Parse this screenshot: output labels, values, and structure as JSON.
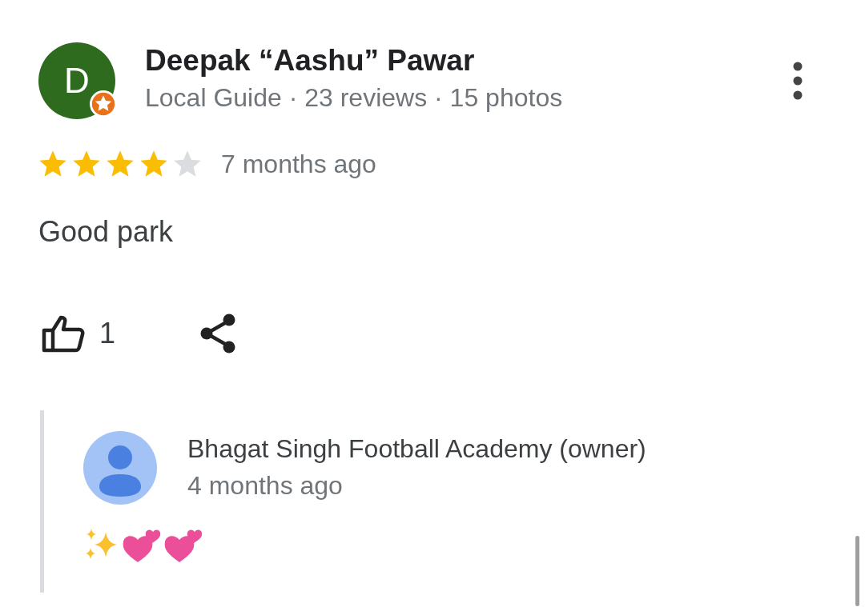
{
  "review": {
    "avatar_letter": "D",
    "local_guide": true,
    "author": "Deepak “Aashu” Pawar",
    "meta": "Local Guide · 23 reviews · 15 photos",
    "stars": 4,
    "time": "7 months ago",
    "text": "Good park",
    "likes": "1"
  },
  "owner_reply": {
    "author": "Bhagat Singh Football Academy (owner)",
    "time": "4 months ago"
  }
}
